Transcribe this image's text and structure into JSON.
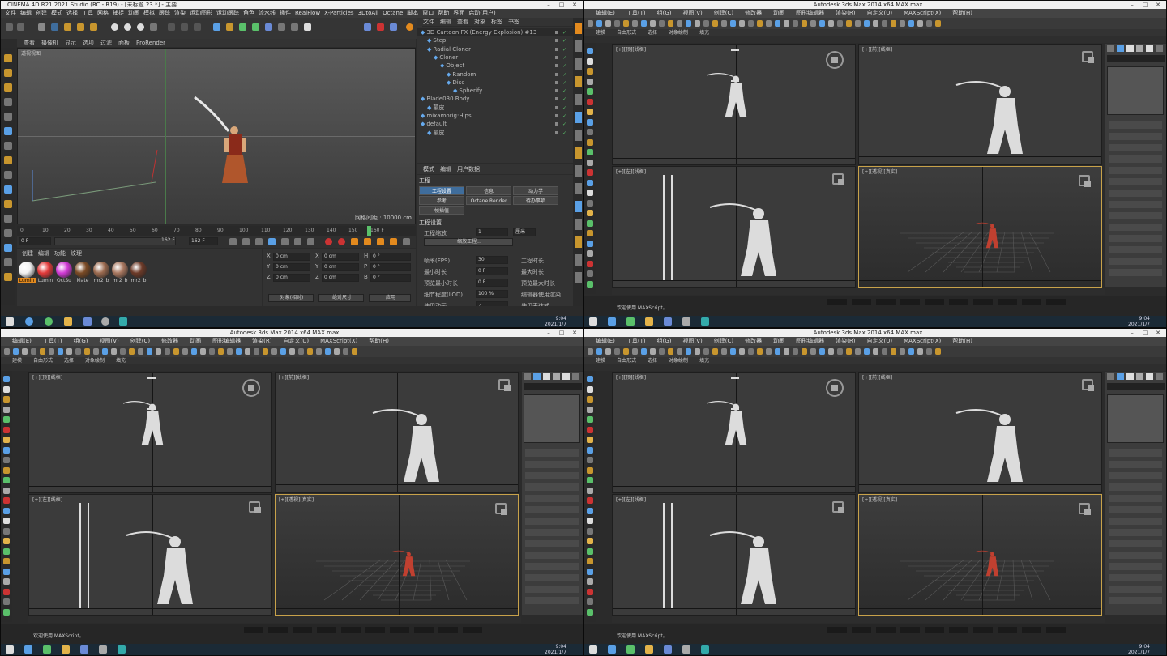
{
  "c4d": {
    "title": "CINEMA 4D R21.2021 Studio (RC - R19) - [未标题 23 *] - 主要",
    "menu": [
      "文件",
      "编辑",
      "创建",
      "模式",
      "选择",
      "工具",
      "网格",
      "捕捉",
      "动画",
      "模拟",
      "跟踪",
      "渲染",
      "运动图形",
      "运动跟踪",
      "角色",
      "流水线",
      "插件",
      "RealFlow",
      "X-Particles",
      "3DtoAll",
      "Octane",
      "脚本",
      "窗口",
      "帮助",
      "界面",
      "启动(用户)"
    ],
    "viewport_menu": [
      "查看",
      "摄像机",
      "显示",
      "选项",
      "过滤",
      "面板",
      "ProRender"
    ],
    "viewport_label": "透视视图",
    "grid_spacing": "网格间距 : 10000 cm",
    "ruler": [
      "0",
      "10",
      "20",
      "30",
      "40",
      "50",
      "60",
      "70",
      "80",
      "90",
      "100",
      "110",
      "120",
      "130",
      "140",
      "150",
      "160 F"
    ],
    "frame_start": "0 F",
    "frame_mid": "162 F",
    "frame_end": "162 F",
    "mat_tabs": [
      "创建",
      "编辑",
      "功能",
      "纹理"
    ],
    "materials": [
      {
        "name": "Lumin",
        "color": "#f2f2f2"
      },
      {
        "name": "Lumin",
        "color": "#e23b3b"
      },
      {
        "name": "OctSu",
        "color": "#d23ad6"
      },
      {
        "name": "Mate",
        "color": "#7a4a25"
      },
      {
        "name": "mr2_b",
        "color": "#9b6a4f"
      },
      {
        "name": "mr2_b",
        "color": "#a8775f"
      },
      {
        "name": "mr2_b",
        "color": "#6c3a28"
      }
    ],
    "coords": [
      {
        "axis": "X",
        "pos": "0 cm",
        "size": "0 cm",
        "rot": "H",
        "rotv": "0 °"
      },
      {
        "axis": "Y",
        "pos": "0 cm",
        "size": "0 cm",
        "rot": "P",
        "rotv": "0 °"
      },
      {
        "axis": "Z",
        "pos": "0 cm",
        "size": "0 cm",
        "rot": "B",
        "rotv": "0 °"
      }
    ],
    "coord_buttons": [
      "对象(相对)",
      "绝对尺寸",
      "应用"
    ],
    "om_menu": [
      "文件",
      "编辑",
      "查看",
      "对象",
      "标签",
      "书签"
    ],
    "objects": [
      {
        "name": "3D Cartoon FX (Energy Explosion) #13",
        "indent": 0
      },
      {
        "name": "Step",
        "indent": 1
      },
      {
        "name": "Radial Cloner",
        "indent": 1
      },
      {
        "name": "Cloner",
        "indent": 2
      },
      {
        "name": "Object",
        "indent": 3
      },
      {
        "name": "Random",
        "indent": 4
      },
      {
        "name": "Disc",
        "indent": 4
      },
      {
        "name": "Spherify",
        "indent": 5
      },
      {
        "name": "Blade030 Body",
        "indent": 0
      },
      {
        "name": "蒙皮",
        "indent": 1
      },
      {
        "name": "mixamorig:Hips",
        "indent": 0
      },
      {
        "name": "default",
        "indent": 0
      },
      {
        "name": "蒙皮",
        "indent": 1
      }
    ],
    "attr_menu": [
      "模式",
      "编辑",
      "用户数据"
    ],
    "attr_title": "工程",
    "attr_tabs": [
      "工程设置",
      "信息",
      "动力学",
      "参考",
      "Octane Render",
      "待办事项",
      "帧插值"
    ],
    "attr_section": "工程设置",
    "fields": [
      {
        "label": "工程缩放",
        "value": "1",
        "unit": "厘米"
      },
      {
        "label": "缩放工程...",
        "value": "",
        "unit": ""
      },
      {
        "label": "帧率(FPS)",
        "value": "30",
        "right": "工程时长"
      },
      {
        "label": "最小时长",
        "value": "0 F",
        "right": "最大时长"
      },
      {
        "label": "预览最小时长",
        "value": "0 F",
        "right": "预览最大时长"
      },
      {
        "label": "细节程度(LOD)",
        "value": "100 %",
        "right": "编辑器使用渲染"
      },
      {
        "label": "使用动画",
        "value": "✓",
        "right": "使用表达式"
      }
    ]
  },
  "max_windows": [
    {
      "title": "Autodesk 3ds Max 2014 x64    MAX.max"
    },
    {
      "title": "Autodesk 3ds Max 2014 x64    MAX.max"
    },
    {
      "title": "Autodesk 3ds Max 2014 x64    MAX.max"
    }
  ],
  "max_menu": [
    "编辑(E)",
    "工具(T)",
    "组(G)",
    "视图(V)",
    "创建(C)",
    "修改器",
    "动画",
    "图形编辑器",
    "渲染(R)",
    "自定义(U)",
    "MAXScript(X)",
    "帮助(H)"
  ],
  "max_ribbon": [
    "建模",
    "自由形式",
    "选择",
    "对象绘制",
    "填充"
  ],
  "max_vp_labels": [
    "[+][顶][线框]",
    "[+][前][线框]",
    "[+][左][线框]",
    "[+][透视][真实]"
  ],
  "max_status": "欢迎使用 MAXScript。",
  "taskbar_time": "2021/1/7",
  "taskbar_clock": "9:04"
}
